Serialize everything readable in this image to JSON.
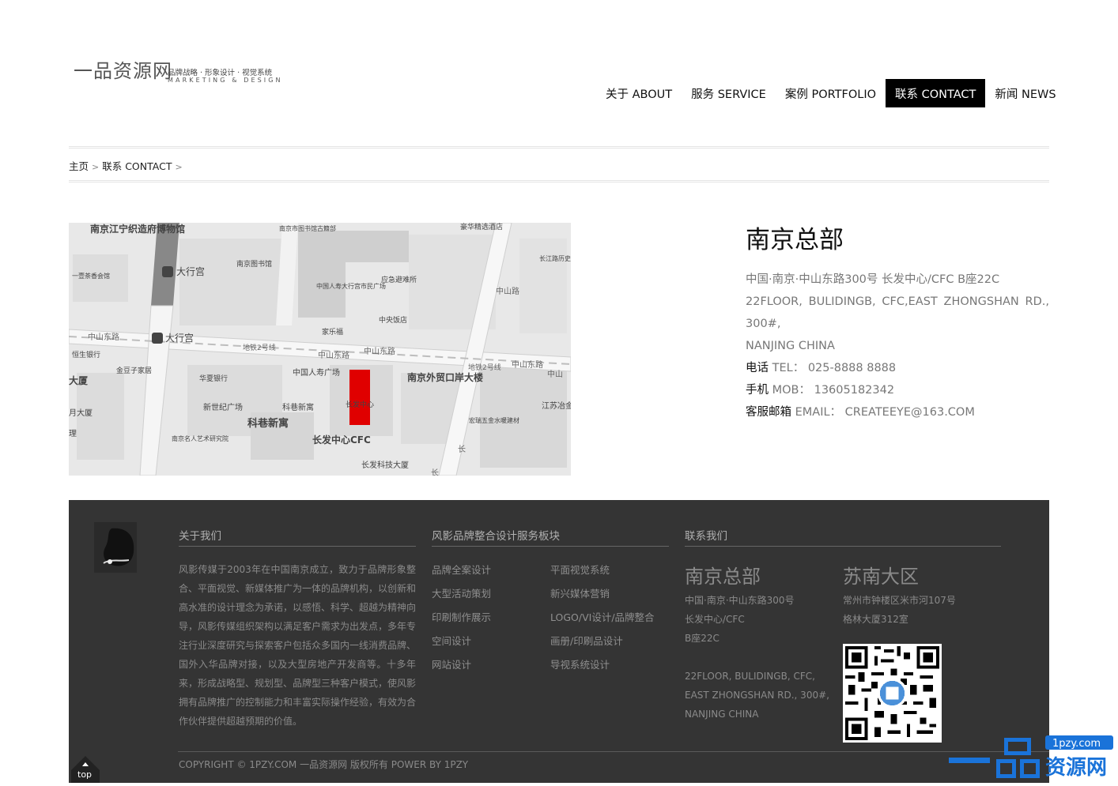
{
  "logo": {
    "name": "一品资源网",
    "tagline": "品牌战略 · 形象设计 · 视觉系统",
    "subtitle": "MARKETING & DESIGN"
  },
  "nav": {
    "items": [
      {
        "label": "关于 ABOUT"
      },
      {
        "label": "服务 SERVICE"
      },
      {
        "label": "案例 PORTFOLIO"
      },
      {
        "label": "联系 CONTACT",
        "active": true
      },
      {
        "label": "新闻 NEWS"
      }
    ]
  },
  "breadcrumb": {
    "home": "主页",
    "sep": ">",
    "current": "联系 CONTACT"
  },
  "map": {
    "labels": {
      "museum": "南京江宁织造府博物馆",
      "library1": "南京市图书馆古籍部",
      "hotel": "豪华精选酒店",
      "daxinggong1": "大行宫",
      "library2": "南京图书馆",
      "changjiang": "长江路历史文化街区",
      "yijiaxiang": "一壹茶香会馆",
      "insurance": "中国人寿大行宫市民广场",
      "emergency": "应急避难所",
      "jialefu": "家乐福",
      "zhongyang": "中央饭店",
      "zhongshanlu1": "中山东路",
      "daxinggong2": "大行宫",
      "metro1": "地铁2号线",
      "zhongshanlu2": "中山东路",
      "zhongshanlu3": "中山东路",
      "metro2": "地铁2号线",
      "zhongshanlu4": "中山东路",
      "zhongshan5": "中山",
      "hengsheng": "恒生银行",
      "jinyuzi": "金豆子家居",
      "huaxia": "华夏银行",
      "renshou": "中国人寿广场",
      "changfa": "长发中心",
      "foreign_trade": "南京外贸口岸大楼",
      "dasha": "大厦",
      "xinshiji": "新世纪广场",
      "kexiang1": "科巷新寓",
      "jiangsu": "江苏冶金",
      "yuedasha": "月大厦",
      "kexiang2": "科巷新寓",
      "hongyang": "宏瑞五金水暖建材",
      "li": "理",
      "mingren": "南京名人艺术研究院",
      "cfc": "长发中心CFC",
      "keji": "长发科技大厦",
      "road_zhongshan": "中山路",
      "road_chang": "长",
      "road_chang2": "长"
    }
  },
  "hq": {
    "title": "南京总部",
    "address_cn": "中国·南京·中山东路300号 长发中心/CFC B座22C",
    "address_en1": "22FLOOR, BULIDINGB, CFC,EAST ZHONGSHAN RD.,",
    "address_en2": "300#,",
    "address_en3": "NANJING CHINA",
    "tel_key": "电话",
    "tel_val": "TEL： 025-8888 8888",
    "mob_key": "手机",
    "mob_val": "MOB： 13605182342",
    "email_key": "客服邮箱",
    "email_val": "EMAIL： CREATEEYE@163.COM"
  },
  "footer": {
    "about_title": "关于我们",
    "about_text": "风影传媒于2003年在中国南京成立，致力于品牌形象整合、平面视觉、新媒体推广为一体的品牌机构，以创新和高水准的设计理念为承诺，以感悟、科学、超越为精神向导，风影传媒组织架构以满足客户需求为出发点，多年专注行业深度研究与探索客户包括众多国内一线消费品牌、国外入华品牌对接，以及大型房地产开发商等。十多年来，形成战略型、规划型、品牌型三种客户模式，使风影拥有品牌推广的控制能力和丰富实际操作经验，有效为合作伙伴提供超越预期的价值。",
    "services_title": "风影品牌整合设计服务板块",
    "services_left": [
      "品牌全案设计",
      "大型活动策划",
      "印刷制作展示",
      "空间设计",
      "网站设计"
    ],
    "services_right": [
      "平面视觉系统",
      "新兴媒体营销",
      "LOGO/VI设计/品牌整合",
      "画册/印刷品设计",
      "导视系统设计"
    ],
    "contact_title": "联系我们",
    "nanjing_title": "南京总部",
    "nanjing_addr1": "中国·南京·中山东路300号",
    "nanjing_addr2": "长发中心/CFC",
    "nanjing_addr3": "B座22C",
    "nanjing_en1": "22FLOOR, BULIDINGB, CFC,",
    "nanjing_en2": "EAST ZHONGSHAN RD., 300#,",
    "nanjing_en3": "NANJING CHINA",
    "sunan_title": "苏南大区",
    "sunan_addr1": "常州市钟楼区米市河107号",
    "sunan_addr2": "格林大厦312室",
    "copyright": "COPYRIGHT © 1PZY.COM 一品资源网 版权所有 POWER BY 1PZY",
    "top_label": "top"
  },
  "watermark": {
    "domain": "1pzy.com",
    "brand": "资源网",
    "glyph": "一品"
  }
}
